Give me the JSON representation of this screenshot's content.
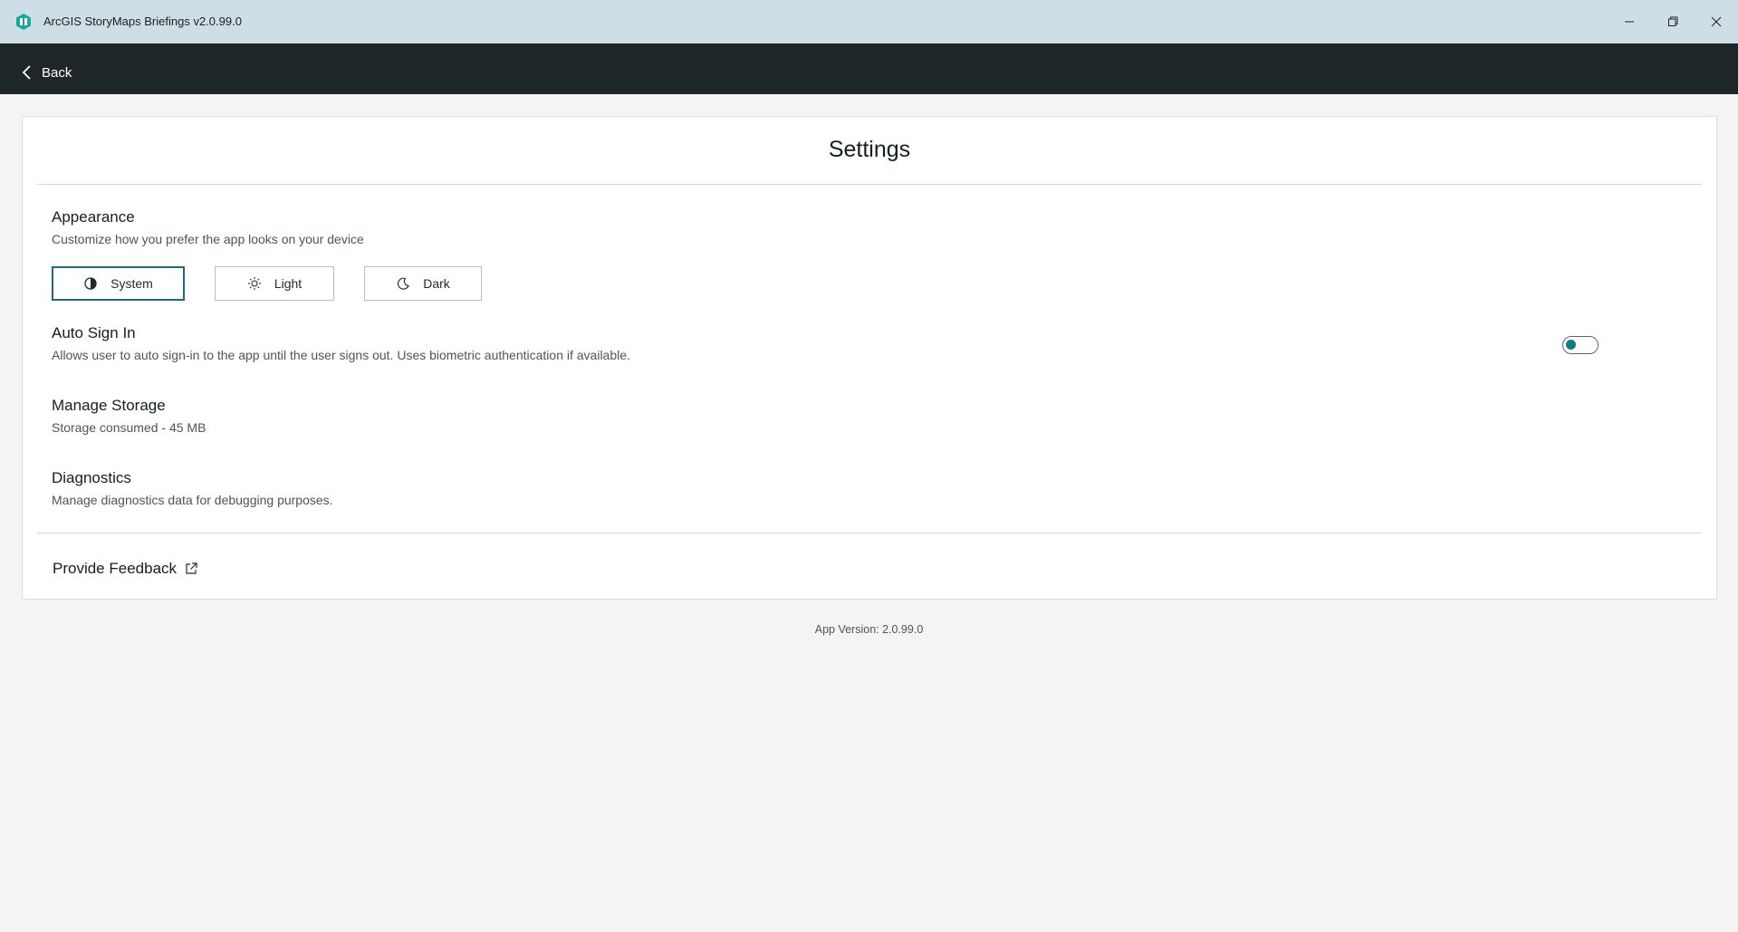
{
  "window": {
    "title": "ArcGIS StoryMaps Briefings v2.0.99.0",
    "icon": "storymaps-app-icon",
    "controls": [
      "minimize-icon",
      "restore-icon",
      "close-icon"
    ]
  },
  "nav": {
    "back_label": "Back"
  },
  "settings": {
    "title": "Settings",
    "appearance": {
      "title": "Appearance",
      "description": "Customize how you prefer the app looks on your device",
      "options": [
        {
          "label": "System",
          "icon": "contrast-icon",
          "selected": true
        },
        {
          "label": "Light",
          "icon": "sun-icon",
          "selected": false
        },
        {
          "label": "Dark",
          "icon": "moon-icon",
          "selected": false
        }
      ]
    },
    "auto_sign_in": {
      "title": "Auto Sign In",
      "description": "Allows user to auto sign-in to the app until the user signs out. Uses biometric authentication if available.",
      "enabled": false
    },
    "storage": {
      "title": "Manage Storage",
      "description": "Storage consumed - 45 MB"
    },
    "diagnostics": {
      "title": "Diagnostics",
      "description": "Manage diagnostics data for debugging purposes."
    },
    "feedback": {
      "label": "Provide Feedback",
      "icon": "external-link-icon"
    }
  },
  "footer": {
    "version": "App Version: 2.0.99.0"
  },
  "colors": {
    "titlebar": "#cfdde6",
    "navbar": "#1e2628",
    "accent": "#1d6d77",
    "toggle_knob": "#0e7e86",
    "background": "#f3f4f3"
  }
}
